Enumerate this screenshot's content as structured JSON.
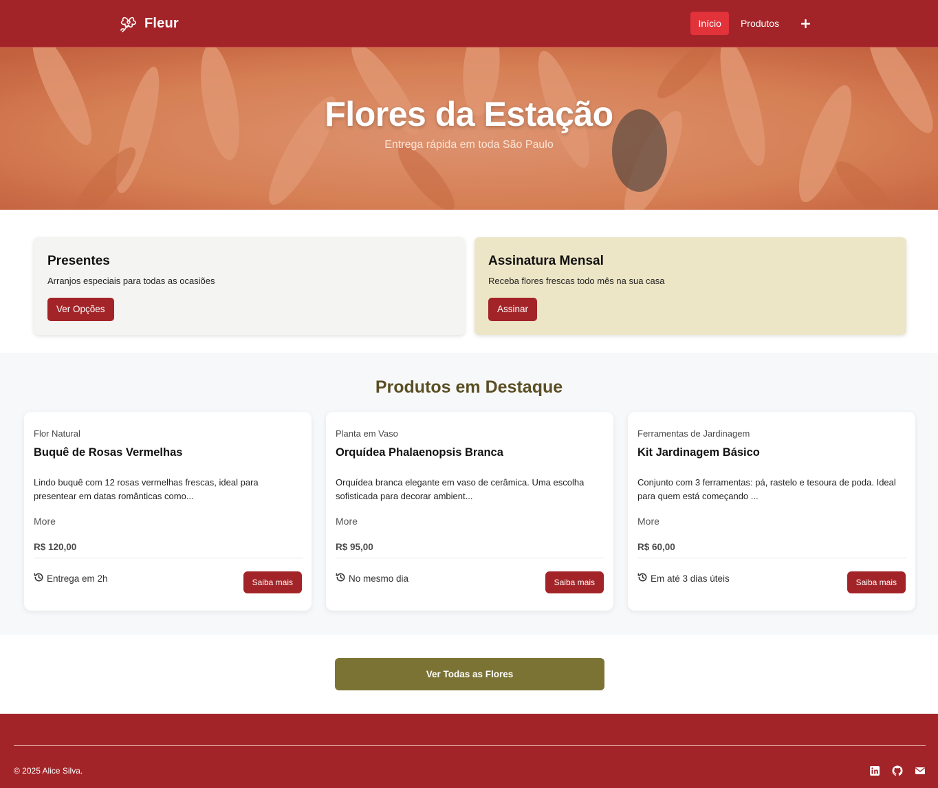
{
  "nav": {
    "brand": "Fleur",
    "links": [
      {
        "label": "Início",
        "active": true
      },
      {
        "label": "Produtos",
        "active": false
      }
    ],
    "plus_icon": "plus-icon"
  },
  "hero": {
    "title": "Flores da Estação",
    "subtitle": "Entrega rápida em toda São Paulo"
  },
  "promos": [
    {
      "title": "Presentes",
      "text": "Arranjos especiais para todas as ocasiões",
      "button": "Ver Opções"
    },
    {
      "title": "Assinatura Mensal",
      "text": "Receba flores frescas todo mês na sua casa",
      "button": "Assinar"
    }
  ],
  "featured": {
    "title": "Produtos em Destaque",
    "products": [
      {
        "category": "Flor Natural",
        "name": "Buquê de Rosas Vermelhas",
        "description": "Lindo buquê com 12 rosas vermelhas frescas, ideal para presentear em datas românticas como...",
        "more": "More",
        "price": "R$ 120,00",
        "delivery": "Entrega em 2h",
        "button": "Saiba mais"
      },
      {
        "category": "Planta em Vaso",
        "name": "Orquídea Phalaenopsis Branca",
        "description": "Orquídea branca elegante em vaso de cerâmica. Uma escolha sofisticada para decorar ambient...",
        "more": "More",
        "price": "R$ 95,00",
        "delivery": "No mesmo dia",
        "button": "Saiba mais"
      },
      {
        "category": "Ferramentas de Jardinagem",
        "name": "Kit Jardinagem Básico",
        "description": "Conjunto com 3 ferramentas: pá, rastelo e tesoura de poda. Ideal para quem está começando ...",
        "more": "More",
        "price": "R$ 60,00",
        "delivery": "Em até 3 dias úteis",
        "button": "Saiba mais"
      }
    ]
  },
  "cta": {
    "label": "Ver Todas as Flores"
  },
  "footer": {
    "copyright": "© 2025 Alice Silva.",
    "socials": [
      "linkedin-icon",
      "github-icon",
      "mail-icon"
    ]
  },
  "colors": {
    "primary": "#a32428",
    "active_nav": "#e2323a",
    "olive": "#7b7334",
    "heading_olive": "#5a4f24",
    "promo_cream": "#ede6c6"
  }
}
